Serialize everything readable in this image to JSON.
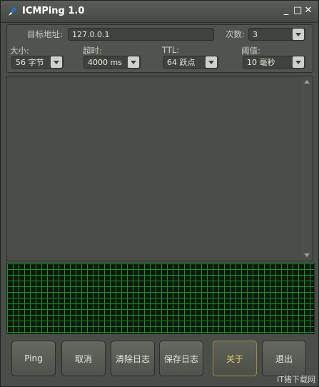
{
  "window": {
    "title": "ICMPing 1.0",
    "minimize_glyph": "_",
    "maximize_glyph": "□",
    "close_glyph": "✕"
  },
  "settings": {
    "target": {
      "label": "目标地址:",
      "value": "127.0.0.1"
    },
    "count": {
      "label": "次数:",
      "value": "3"
    },
    "size": {
      "label": "大小:",
      "value": "56 字节"
    },
    "timeout": {
      "label": "超时:",
      "value": "4000 ms"
    },
    "ttl": {
      "label": "TTL:",
      "value": "64 跃点"
    },
    "threshold": {
      "label": "阈值:",
      "value": "10 毫秒"
    }
  },
  "buttons": {
    "ping": "Ping",
    "cancel": "取消",
    "clear_log": "清除日志",
    "save_log": "保存日志",
    "about": "关于",
    "exit": "退出"
  },
  "watermark": "IT猪下载网",
  "colors": {
    "graph_background": "#0c1a0c",
    "graph_grid": "#1f8f2c",
    "active_button_text": "#e8cf6b"
  }
}
